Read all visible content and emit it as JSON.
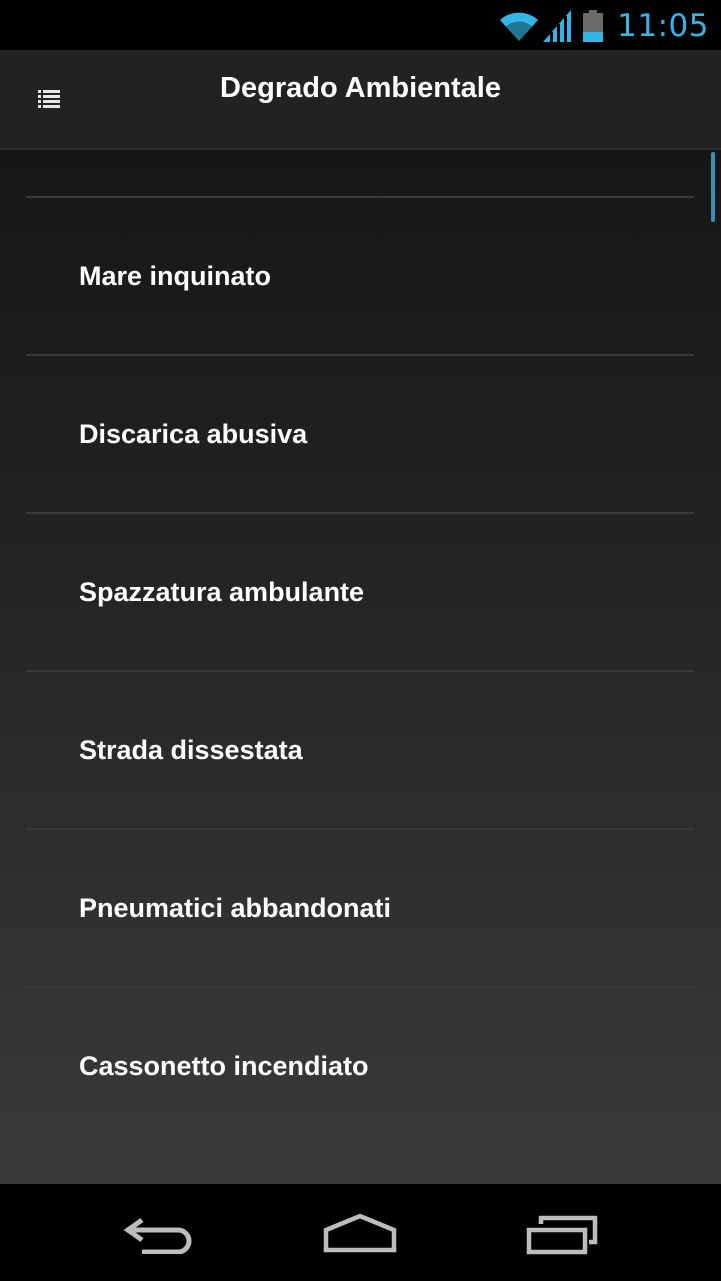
{
  "status_bar": {
    "time": "11:05",
    "icons": [
      "wifi-icon",
      "signal-icon",
      "battery-icon"
    ],
    "accent_color": "#33b5e5"
  },
  "action_bar": {
    "title": "Degrado Ambientale",
    "menu_icon": "list-menu-icon"
  },
  "list": {
    "items": [
      {
        "label": "Mare inquinato"
      },
      {
        "label": "Discarica abusiva"
      },
      {
        "label": "Spazzatura ambulante"
      },
      {
        "label": "Strada dissestata"
      },
      {
        "label": "Pneumatici abbandonati"
      },
      {
        "label": "Cassonetto incendiato"
      }
    ]
  },
  "nav_bar": {
    "buttons": [
      "back-icon",
      "home-icon",
      "recent-apps-icon"
    ]
  }
}
